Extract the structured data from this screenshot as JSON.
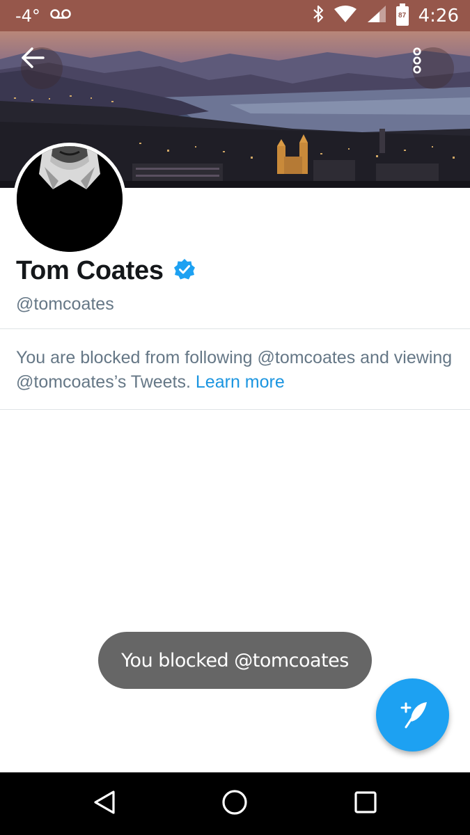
{
  "status_bar": {
    "temperature": "-4°",
    "time": "4:26",
    "battery_level": "87",
    "icons": [
      "voicemail-icon",
      "bluetooth-icon",
      "wifi-icon",
      "cell-signal-icon",
      "battery-icon"
    ],
    "background_color": "#96574b"
  },
  "header": {
    "back_icon": "arrow-left-icon",
    "more_icon": "more-vertical-icon"
  },
  "profile": {
    "name": "Tom Coates",
    "handle": "@tomcoates",
    "verified": true,
    "verified_color": "#1da1f2"
  },
  "blocked_notice": {
    "text": "You are blocked from following @tomcoates and viewing @tomcoates’s Tweets. ",
    "link_label": "Learn more",
    "link_color": "#1b95e0"
  },
  "toast": {
    "message": "You blocked @tomcoates"
  },
  "fab": {
    "icon": "compose-tweet-icon",
    "color": "#1da1f2"
  },
  "nav_bar": {
    "icons": [
      "nav-back-icon",
      "nav-home-icon",
      "nav-recents-icon"
    ]
  }
}
